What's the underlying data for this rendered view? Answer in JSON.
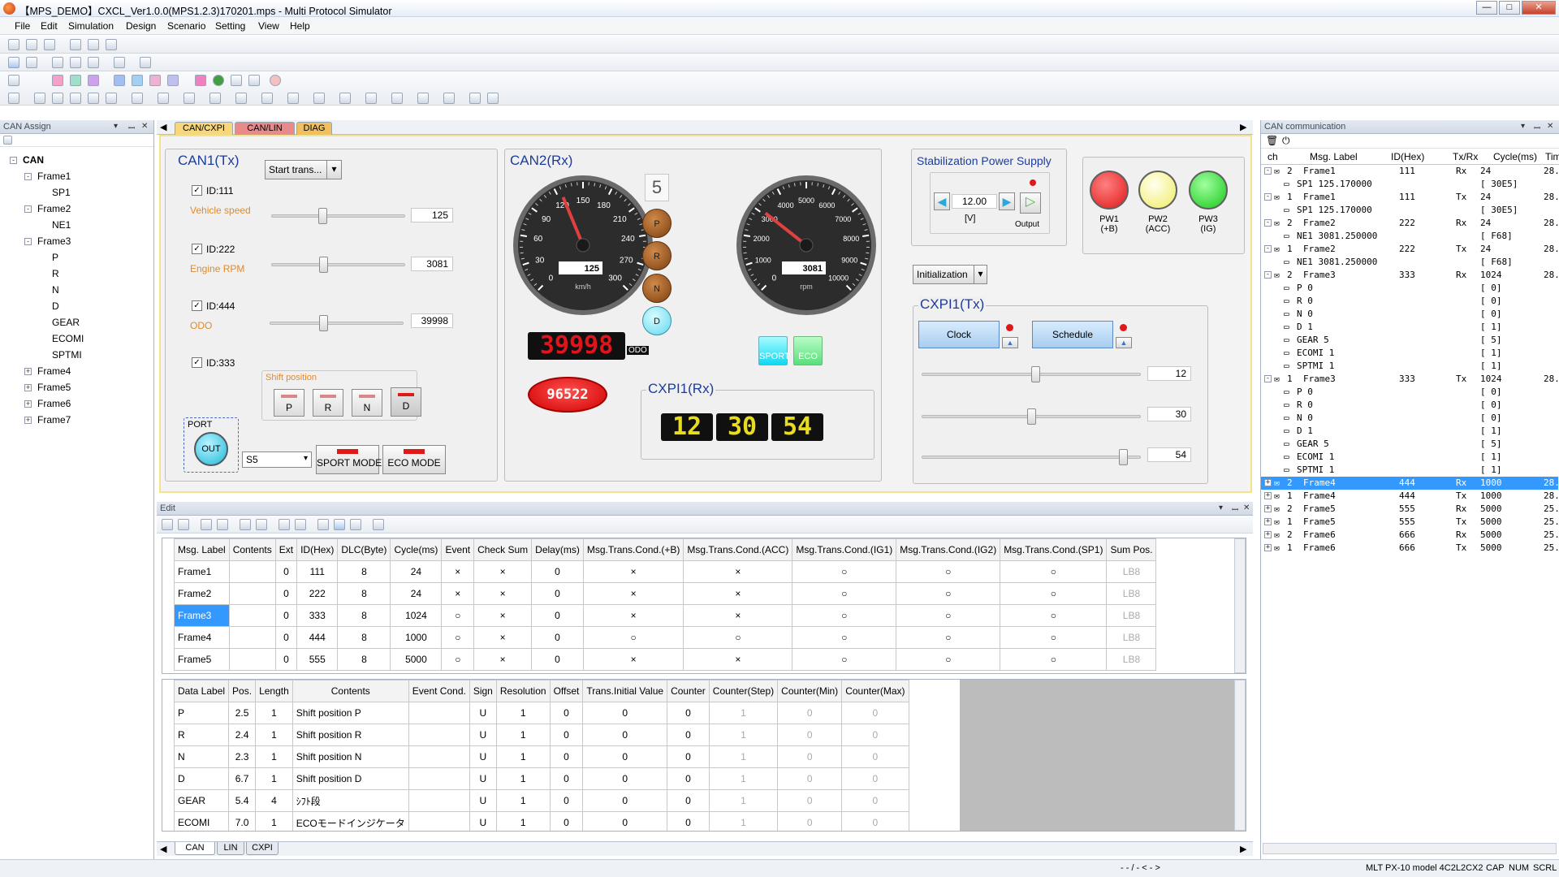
{
  "title": "【MPS_DEMO】CXCL_Ver1.0.0(MPS1.2.3)170201.mps - Multi Protocol Simulator",
  "window_buttons": [
    "—",
    "□",
    "✕"
  ],
  "menu": [
    "File",
    "Edit",
    "Simulation",
    "Design",
    "Scenario",
    "Setting",
    "View",
    "Help"
  ],
  "left_panel": {
    "title": "CAN Assign",
    "tree": [
      {
        "label": "CAN",
        "depth": 0,
        "exp": "-"
      },
      {
        "label": "Frame1",
        "depth": 1,
        "exp": "-"
      },
      {
        "label": "SP1",
        "depth": 2,
        "exp": ""
      },
      {
        "label": "Frame2",
        "depth": 1,
        "exp": "-"
      },
      {
        "label": "NE1",
        "depth": 2,
        "exp": ""
      },
      {
        "label": "Frame3",
        "depth": 1,
        "exp": "-"
      },
      {
        "label": "P",
        "depth": 2,
        "exp": ""
      },
      {
        "label": "R",
        "depth": 2,
        "exp": ""
      },
      {
        "label": "N",
        "depth": 2,
        "exp": ""
      },
      {
        "label": "D",
        "depth": 2,
        "exp": ""
      },
      {
        "label": "GEAR",
        "depth": 2,
        "exp": ""
      },
      {
        "label": "ECOMI",
        "depth": 2,
        "exp": ""
      },
      {
        "label": "SPTMI",
        "depth": 2,
        "exp": ""
      },
      {
        "label": "Frame4",
        "depth": 1,
        "exp": "+"
      },
      {
        "label": "Frame5",
        "depth": 1,
        "exp": "+"
      },
      {
        "label": "Frame6",
        "depth": 1,
        "exp": "+"
      },
      {
        "label": "Frame7",
        "depth": 1,
        "exp": "+"
      }
    ]
  },
  "design_tabs": [
    {
      "label": "CAN/CXPI",
      "color": "#f7d77a"
    },
    {
      "label": "CAN/LIN",
      "color": "#e88a8a"
    },
    {
      "label": "DIAG",
      "color": "#f0c060"
    }
  ],
  "can1": {
    "title": "CAN1(Tx)",
    "start_btn": "Start trans...",
    "id1": "ID:111",
    "speed_label": "Vehicle speed",
    "speed_value": "125",
    "speed_frac": 0.38,
    "id2": "ID:222",
    "rpm_label": "Engine RPM",
    "rpm_value": "3081",
    "rpm_frac": 0.39,
    "id3": "ID:444",
    "odo_label": "ODO",
    "odo_value": "39998",
    "odo_frac": 0.4,
    "id4": "ID:333",
    "shift_label": "Shift position",
    "shift_buttons": [
      "P",
      "R",
      "N",
      "D"
    ],
    "port_label": "PORT",
    "out_label": "OUT",
    "select_value": "S5",
    "sport_btn": "SPORT MODE",
    "eco_btn": "ECO MODE"
  },
  "can2": {
    "title": "CAN2(Rx)",
    "speed_ticks": [
      "0",
      "30",
      "60",
      "90",
      "120",
      "150",
      "180",
      "210",
      "240",
      "270",
      "300"
    ],
    "speed_value": "125",
    "speed_unit": "km/h",
    "speed_frac": 0.4167,
    "gear_num": "5",
    "gears": [
      "P",
      "R",
      "N",
      "D"
    ],
    "rpm_ticks": [
      "0",
      "1000",
      "2000",
      "3000",
      "4000",
      "5000",
      "6000",
      "7000",
      "8000",
      "9000",
      "10000"
    ],
    "rpm_value": "3081",
    "rpm_unit": "rpm",
    "rpm_frac": 0.3081,
    "odo_display": "39998",
    "odo_unit": "ODO",
    "sport_lamp": "SPORT",
    "eco_lamp": "ECO",
    "red_display": "96522"
  },
  "cxpi_rx": {
    "title": "CXPI1(Rx)",
    "h": "12",
    "m": "30",
    "s": "54"
  },
  "power": {
    "title": "Stabilization Power Supply",
    "value": "12.00",
    "unit": "[V]",
    "output_label": "Output",
    "init_btn": "Initialization",
    "lamps": [
      {
        "label": "PW1\n(+B)",
        "color": "#e01818"
      },
      {
        "label": "PW2\n(ACC)",
        "color": "#f4f060"
      },
      {
        "label": "PW3\n(IG)",
        "color": "#28d028"
      }
    ]
  },
  "cxpi_tx": {
    "title": "CXPI1(Tx)",
    "clock_btn": "Clock",
    "schedule_btn": "Schedule",
    "sliders": [
      {
        "value": "12",
        "frac": 0.52
      },
      {
        "value": "30",
        "frac": 0.5
      },
      {
        "value": "54",
        "frac": 0.92
      }
    ]
  },
  "edit": {
    "title": "Edit",
    "msg_headers": [
      "Msg. Label",
      "Contents",
      "Ext",
      "ID(Hex)",
      "DLC(Byte)",
      "Cycle(ms)",
      "Event",
      "Check Sum",
      "Delay(ms)",
      "Msg.Trans.Cond.(+B)",
      "Msg.Trans.Cond.(ACC)",
      "Msg.Trans.Cond.(IG1)",
      "Msg.Trans.Cond.(IG2)",
      "Msg.Trans.Cond.(SP1)",
      "Sum Pos."
    ],
    "msg_rows": [
      [
        "Frame1",
        "",
        "0",
        "111",
        "8",
        "24",
        "×",
        "×",
        "0",
        "×",
        "×",
        "○",
        "○",
        "○",
        "LB8"
      ],
      [
        "Frame2",
        "",
        "0",
        "222",
        "8",
        "24",
        "×",
        "×",
        "0",
        "×",
        "×",
        "○",
        "○",
        "○",
        "LB8"
      ],
      [
        "Frame3",
        "",
        "0",
        "333",
        "8",
        "1024",
        "○",
        "×",
        "0",
        "×",
        "×",
        "○",
        "○",
        "○",
        "LB8"
      ],
      [
        "Frame4",
        "",
        "0",
        "444",
        "8",
        "1000",
        "○",
        "×",
        "0",
        "○",
        "○",
        "○",
        "○",
        "○",
        "LB8"
      ],
      [
        "Frame5",
        "",
        "0",
        "555",
        "8",
        "5000",
        "○",
        "×",
        "0",
        "×",
        "×",
        "○",
        "○",
        "○",
        "LB8"
      ]
    ],
    "data_headers": [
      "Data Label",
      "Pos.",
      "Length",
      "Contents",
      "Event Cond.",
      "Sign",
      "Resolution",
      "Offset",
      "Trans.Initial Value",
      "Counter",
      "Counter(Step)",
      "Counter(Min)",
      "Counter(Max)"
    ],
    "data_rows": [
      [
        "P",
        "2.5",
        "1",
        "Shift position P",
        "",
        "U",
        "1",
        "0",
        "0",
        "0",
        "1",
        "0",
        "0"
      ],
      [
        "R",
        "2.4",
        "1",
        "Shift position R",
        "",
        "U",
        "1",
        "0",
        "0",
        "0",
        "1",
        "0",
        "0"
      ],
      [
        "N",
        "2.3",
        "1",
        "Shift position N",
        "",
        "U",
        "1",
        "0",
        "0",
        "0",
        "1",
        "0",
        "0"
      ],
      [
        "D",
        "6.7",
        "1",
        "Shift position D",
        "",
        "U",
        "1",
        "0",
        "0",
        "0",
        "1",
        "0",
        "0"
      ],
      [
        "GEAR",
        "5.4",
        "4",
        "ｼﾌﾄ段",
        "",
        "U",
        "1",
        "0",
        "0",
        "0",
        "1",
        "0",
        "0"
      ],
      [
        "ECOMI",
        "7.0",
        "1",
        "ECOモードインジケータ",
        "",
        "U",
        "1",
        "0",
        "0",
        "0",
        "1",
        "0",
        "0"
      ]
    ],
    "bottom_tabs": [
      "CAN",
      "LIN",
      "CXPI"
    ]
  },
  "right_panel": {
    "title": "CAN communication",
    "headers": [
      "ch",
      "Msg. Label",
      "ID(Hex)",
      "Tx/Rx",
      "Cycle(ms)",
      "Tim"
    ],
    "rows": [
      {
        "exp": "-",
        "ch": "2",
        "label": "Frame1",
        "id": "111",
        "txrx": "Rx",
        "cycle": "24",
        "tim": "28.",
        "indent": 0
      },
      {
        "exp": "",
        "ch": "",
        "label": "SP1    125.170000",
        "id": "",
        "txrx": "",
        "cycle": "[   30E5]",
        "tim": "",
        "indent": 1
      },
      {
        "exp": "-",
        "ch": "1",
        "label": "Frame1",
        "id": "111",
        "txrx": "Tx",
        "cycle": "24",
        "tim": "28.",
        "indent": 0
      },
      {
        "exp": "",
        "ch": "",
        "label": "SP1    125.170000",
        "id": "",
        "txrx": "",
        "cycle": "[   30E5]",
        "tim": "",
        "indent": 1
      },
      {
        "exp": "-",
        "ch": "2",
        "label": "Frame2",
        "id": "222",
        "txrx": "Rx",
        "cycle": "24",
        "tim": "28.",
        "indent": 0
      },
      {
        "exp": "",
        "ch": "",
        "label": "NE1    3081.250000",
        "id": "",
        "txrx": "",
        "cycle": "[    F68]",
        "tim": "",
        "indent": 1
      },
      {
        "exp": "-",
        "ch": "1",
        "label": "Frame2",
        "id": "222",
        "txrx": "Tx",
        "cycle": "24",
        "tim": "28.",
        "indent": 0
      },
      {
        "exp": "",
        "ch": "",
        "label": "NE1    3081.250000",
        "id": "",
        "txrx": "",
        "cycle": "[    F68]",
        "tim": "",
        "indent": 1
      },
      {
        "exp": "-",
        "ch": "2",
        "label": "Frame3",
        "id": "333",
        "txrx": "Rx",
        "cycle": "1024",
        "tim": "28.",
        "indent": 0
      },
      {
        "exp": "",
        "ch": "",
        "label": "P      0",
        "id": "",
        "txrx": "",
        "cycle": "[      0]",
        "tim": "",
        "indent": 1
      },
      {
        "exp": "",
        "ch": "",
        "label": "R      0",
        "id": "",
        "txrx": "",
        "cycle": "[      0]",
        "tim": "",
        "indent": 1
      },
      {
        "exp": "",
        "ch": "",
        "label": "N      0",
        "id": "",
        "txrx": "",
        "cycle": "[      0]",
        "tim": "",
        "indent": 1
      },
      {
        "exp": "",
        "ch": "",
        "label": "D      1",
        "id": "",
        "txrx": "",
        "cycle": "[      1]",
        "tim": "",
        "indent": 1
      },
      {
        "exp": "",
        "ch": "",
        "label": "GEAR   5",
        "id": "",
        "txrx": "",
        "cycle": "[      5]",
        "tim": "",
        "indent": 1
      },
      {
        "exp": "",
        "ch": "",
        "label": "ECOMI  1",
        "id": "",
        "txrx": "",
        "cycle": "[      1]",
        "tim": "",
        "indent": 1
      },
      {
        "exp": "",
        "ch": "",
        "label": "SPTMI  1",
        "id": "",
        "txrx": "",
        "cycle": "[      1]",
        "tim": "",
        "indent": 1
      },
      {
        "exp": "-",
        "ch": "1",
        "label": "Frame3",
        "id": "333",
        "txrx": "Tx",
        "cycle": "1024",
        "tim": "28.",
        "indent": 0
      },
      {
        "exp": "",
        "ch": "",
        "label": "P      0",
        "id": "",
        "txrx": "",
        "cycle": "[      0]",
        "tim": "",
        "indent": 1
      },
      {
        "exp": "",
        "ch": "",
        "label": "R      0",
        "id": "",
        "txrx": "",
        "cycle": "[      0]",
        "tim": "",
        "indent": 1
      },
      {
        "exp": "",
        "ch": "",
        "label": "N      0",
        "id": "",
        "txrx": "",
        "cycle": "[      0]",
        "tim": "",
        "indent": 1
      },
      {
        "exp": "",
        "ch": "",
        "label": "D      1",
        "id": "",
        "txrx": "",
        "cycle": "[      1]",
        "tim": "",
        "indent": 1
      },
      {
        "exp": "",
        "ch": "",
        "label": "GEAR   5",
        "id": "",
        "txrx": "",
        "cycle": "[      5]",
        "tim": "",
        "indent": 1
      },
      {
        "exp": "",
        "ch": "",
        "label": "ECOMI  1",
        "id": "",
        "txrx": "",
        "cycle": "[      1]",
        "tim": "",
        "indent": 1
      },
      {
        "exp": "",
        "ch": "",
        "label": "SPTMI  1",
        "id": "",
        "txrx": "",
        "cycle": "[      1]",
        "tim": "",
        "indent": 1
      },
      {
        "exp": "+",
        "ch": "2",
        "label": "Frame4",
        "id": "444",
        "txrx": "Rx",
        "cycle": "1000",
        "tim": "28.",
        "indent": 0,
        "selected": true
      },
      {
        "exp": "+",
        "ch": "1",
        "label": "Frame4",
        "id": "444",
        "txrx": "Tx",
        "cycle": "1000",
        "tim": "28.",
        "indent": 0
      },
      {
        "exp": "+",
        "ch": "2",
        "label": "Frame5",
        "id": "555",
        "txrx": "Rx",
        "cycle": "5000",
        "tim": "25.",
        "indent": 0
      },
      {
        "exp": "+",
        "ch": "1",
        "label": "Frame5",
        "id": "555",
        "txrx": "Tx",
        "cycle": "5000",
        "tim": "25.",
        "indent": 0
      },
      {
        "exp": "+",
        "ch": "2",
        "label": "Frame6",
        "id": "666",
        "txrx": "Rx",
        "cycle": "5000",
        "tim": "25.",
        "indent": 0
      },
      {
        "exp": "+",
        "ch": "1",
        "label": "Frame6",
        "id": "666",
        "txrx": "Tx",
        "cycle": "5000",
        "tim": "25.",
        "indent": 0
      }
    ]
  },
  "status": {
    "left": "",
    "mid": "- - / - < - >",
    "right": "MLT PX-10 model 4C2L2CX2",
    "flags": [
      "CAP",
      "NUM",
      "SCRL"
    ]
  },
  "colors": {
    "selection": "#3399ff",
    "accent_blue": "#1c3c9c",
    "red_led": "#e0141c"
  }
}
